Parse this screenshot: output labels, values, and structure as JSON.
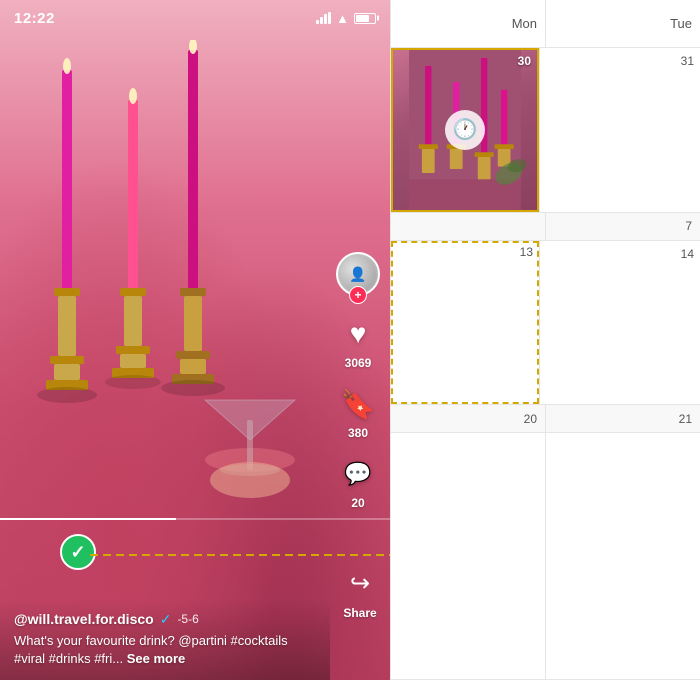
{
  "left": {
    "status_time": "12:22",
    "username": "@will.travel.for.disco",
    "score": "-5-6",
    "caption": "What's your favourite drink? @partini\n#cocktails #viral #drinks #fri...",
    "see_more": "See more",
    "likes": "3069",
    "bookmarks": "380",
    "comments": "20",
    "share_label": "Share"
  },
  "calendar": {
    "days": [
      {
        "label": "Mon",
        "num": ""
      },
      {
        "label": "Tue",
        "num": ""
      }
    ],
    "rows": [
      {
        "cells": [
          {
            "date": "30",
            "hasEvent": true
          },
          {
            "date": "31"
          }
        ]
      },
      {
        "cells": [
          {
            "date": "13",
            "hasDashed": true
          },
          {
            "date": "14"
          }
        ]
      },
      {
        "cells": [
          {
            "date": "20"
          },
          {
            "date": "21"
          }
        ]
      }
    ],
    "week_numbers": [
      "",
      "7",
      ""
    ]
  }
}
